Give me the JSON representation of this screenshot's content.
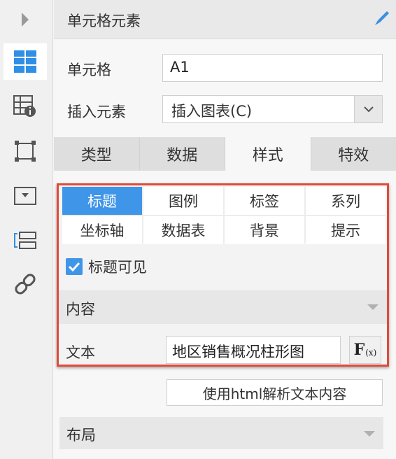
{
  "panel": {
    "title": "单元格元素"
  },
  "cell": {
    "label": "单元格",
    "value": "A1"
  },
  "insert": {
    "label": "插入元素",
    "selected": "插入图表(C)"
  },
  "main_tabs": [
    {
      "label": "类型",
      "active": false
    },
    {
      "label": "数据",
      "active": false
    },
    {
      "label": "样式",
      "active": true
    },
    {
      "label": "特效",
      "active": false
    }
  ],
  "sub_tabs": [
    {
      "label": "标题",
      "active": true
    },
    {
      "label": "图例",
      "active": false
    },
    {
      "label": "标签",
      "active": false
    },
    {
      "label": "系列",
      "active": false
    },
    {
      "label": "坐标轴",
      "active": false
    },
    {
      "label": "数据表",
      "active": false
    },
    {
      "label": "背景",
      "active": false
    },
    {
      "label": "提示",
      "active": false
    }
  ],
  "title_visible": {
    "label": "标题可见",
    "checked": true
  },
  "content_section": {
    "label": "内容"
  },
  "text_field": {
    "label": "文本",
    "value": "地区销售概况柱形图"
  },
  "formula_button": {
    "label": "F",
    "sub": "(x)"
  },
  "html_button": {
    "label": "使用html解析文本内容"
  },
  "layout_section": {
    "label": "布局"
  },
  "colors": {
    "accent": "#3f95e8",
    "highlight_border": "#e04a3a"
  }
}
